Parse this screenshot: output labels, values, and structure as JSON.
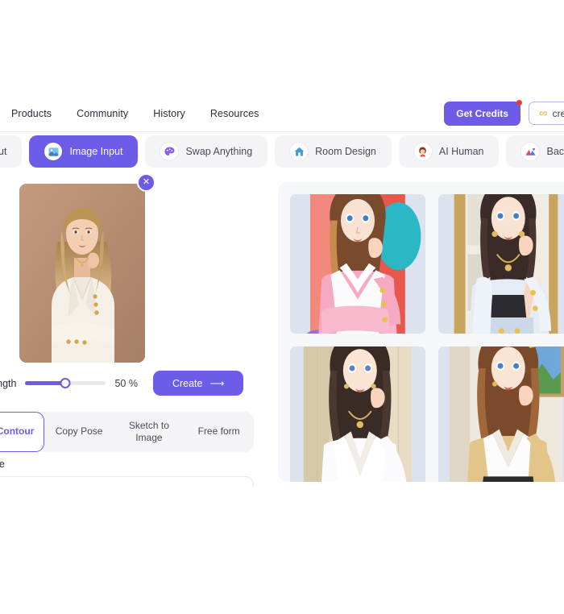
{
  "header": {
    "nav_items": [
      {
        "label": "Products"
      },
      {
        "label": "Community"
      },
      {
        "label": "History"
      },
      {
        "label": "Resources"
      }
    ],
    "get_credits_label": "Get Credits",
    "credits_label": "credits",
    "credits_icon": "infinity-icon",
    "notification_dot_color": "#ef3b2d"
  },
  "tabs": [
    {
      "label": "ut",
      "icon": "text-input-icon",
      "active": false,
      "clipped": true
    },
    {
      "label": "Image Input",
      "icon": "image-icon",
      "active": true,
      "clipped": false
    },
    {
      "label": "Swap Anything",
      "icon": "palette-icon",
      "active": false,
      "clipped": false
    },
    {
      "label": "Room Design",
      "icon": "house-icon",
      "active": false,
      "clipped": false
    },
    {
      "label": "AI Human",
      "icon": "person-icon",
      "active": false,
      "clipped": false
    },
    {
      "label": "Background",
      "icon": "mountain-icon",
      "active": false,
      "clipped": false
    }
  ],
  "left_panel": {
    "upload": {
      "close_label": "✕",
      "image_alt": "uploaded-portrait-photo"
    },
    "strength": {
      "label": "rength",
      "value_text": "50 %",
      "percent": 50
    },
    "create_button": {
      "label": "Create",
      "arrow": "⟶"
    },
    "modes": [
      {
        "label": "py Contour",
        "active": true
      },
      {
        "label": "Copy Pose",
        "active": false
      },
      {
        "label": "Sketch to Image",
        "active": false
      },
      {
        "label": "Free form",
        "active": false
      }
    ],
    "section_label": "nage"
  },
  "results": {
    "cards": [
      {
        "name": "result-image-1"
      },
      {
        "name": "result-image-2"
      },
      {
        "name": "result-image-3"
      },
      {
        "name": "result-image-4"
      }
    ]
  },
  "colors": {
    "accent": "#6c5ce7",
    "tab_inactive_bg": "#f4f4f7",
    "results_bg": "#f6f7fa",
    "card_placeholder": "#dde3ee",
    "notification": "#ef3b2d",
    "credits_icon": "#e8c96a"
  }
}
